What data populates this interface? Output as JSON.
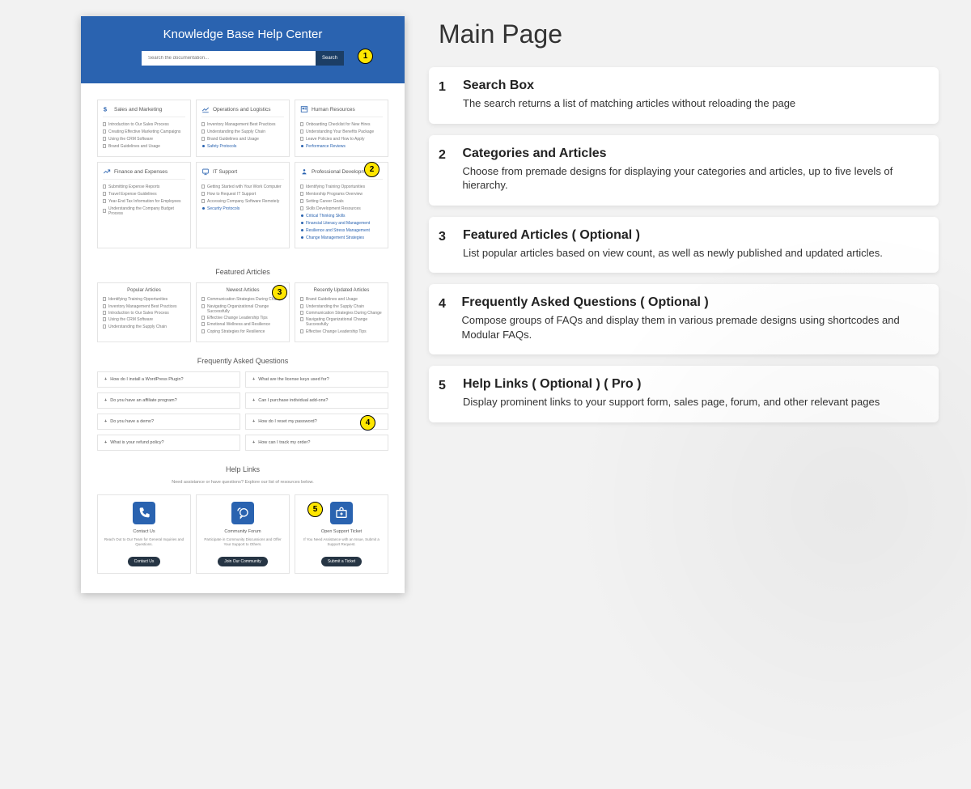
{
  "pageTitle": "Main Page",
  "hero": {
    "title": "Knowledge Base Help Center",
    "placeholder": "Search the documentation...",
    "button": "Search"
  },
  "categories": [
    {
      "title": "Sales and Marketing",
      "items": [
        "Introduction to Our Sales Process",
        "Creating Effective Marketing Campaigns",
        "Using the CRM Software",
        "Brand Guidelines and Usage"
      ],
      "blueItems": []
    },
    {
      "title": "Operations and Logistics",
      "items": [
        "Inventory Management Best Practices",
        "Understanding the Supply Chain",
        "Brand Guidelines and Usage"
      ],
      "blueItems": [
        "Safety Protocols"
      ]
    },
    {
      "title": "Human Resources",
      "items": [
        "Onboarding Checklist for New Hires",
        "Understanding Your Benefits Package",
        "Leave Policies and How to Apply"
      ],
      "blueItems": [
        "Performance Reviews"
      ]
    },
    {
      "title": "Finance and Expenses",
      "items": [
        "Submitting Expense Reports",
        "Travel Expense Guidelines",
        "Year-End Tax Information for Employees",
        "Understanding the Company Budget Process"
      ],
      "blueItems": []
    },
    {
      "title": "IT Support",
      "items": [
        "Getting Started with Your Work Computer",
        "How to Request IT Support",
        "Accessing Company Software Remotely"
      ],
      "blueItems": [
        "Security Protocols"
      ]
    },
    {
      "title": "Professional Development",
      "items": [
        "Identifying Training Opportunities",
        "Mentorship Programs Overview",
        "Setting Career Goals",
        "Skills Development Resources"
      ],
      "blueItems": [
        "Critical Thinking Skills",
        "Financial Literacy and Management",
        "Resilience and Stress Management",
        "Change Management Strategies"
      ]
    }
  ],
  "featured": {
    "title": "Featured Articles",
    "cols": [
      {
        "title": "Popular Articles",
        "items": [
          "Identifying Training Opportunities",
          "Inventory Management Best Practices",
          "Introduction to Our Sales Process",
          "Using the CRM Software",
          "Understanding the Supply Chain"
        ]
      },
      {
        "title": "Newest Articles",
        "items": [
          "Communication Strategies During Change",
          "Navigating Organizational Change Successfully",
          "Effective Change Leadership Tips",
          "Emotional Wellness and Resilience",
          "Coping Strategies for Resilience"
        ]
      },
      {
        "title": "Recently Updated Articles",
        "items": [
          "Brand Guidelines and Usage",
          "Understanding the Supply Chain",
          "Communication Strategies During Change",
          "Navigating Organizational Change Successfully",
          "Effective Change Leadership Tips"
        ]
      }
    ]
  },
  "faq": {
    "title": "Frequently Asked Questions",
    "left": [
      "How do I install a WordPress Plugin?",
      "Do you have an affiliate program?",
      "Do you have a demo?",
      "What is your refund policy?"
    ],
    "right": [
      "What are the license keys used for?",
      "Can I purchase individual add-ons?",
      "How do I reset my password?",
      "How can I track my order?"
    ]
  },
  "help": {
    "title": "Help Links",
    "subtitle": "Need assistance or have questions? Explore our list of resources below.",
    "cards": [
      {
        "title": "Contact Us",
        "desc": "Reach Out to Our Team for General Inquiries and Questions.",
        "btn": "Contact Us"
      },
      {
        "title": "Community Forum",
        "desc": "Participate in Community Discussions and Offer Your Support to Others.",
        "btn": "Join Our Community"
      },
      {
        "title": "Open Support Ticket",
        "desc": "If You Need Assistance with an Issue, Submit a Support Request.",
        "btn": "Submit a Ticket"
      }
    ]
  },
  "descriptions": [
    {
      "num": "1",
      "title": "Search Box",
      "body": "The search returns a list of matching articles without reloading the page"
    },
    {
      "num": "2",
      "title": "Categories and Articles",
      "body": "Choose from premade designs for displaying your categories and articles, up to five levels of hierarchy."
    },
    {
      "num": "3",
      "title": "Featured Articles ( Optional )",
      "body": "List popular articles based on view count, as well as newly published and updated articles."
    },
    {
      "num": "4",
      "title": "Frequently Asked Questions ( Optional )",
      "body": "Compose groups of FAQs and display them in various premade designs using shortcodes and Modular FAQs."
    },
    {
      "num": "5",
      "title": "Help Links ( Optional ) ( Pro )",
      "body": "Display prominent links to your support form, sales page, forum, and other relevant pages"
    }
  ],
  "calloutPositions": [
    {
      "top": "60",
      "left": "442"
    },
    {
      "top": "200",
      "left": "450"
    },
    {
      "top": "352",
      "left": "336"
    },
    {
      "top": "513",
      "left": "445"
    },
    {
      "top": "620",
      "left": "380"
    }
  ]
}
